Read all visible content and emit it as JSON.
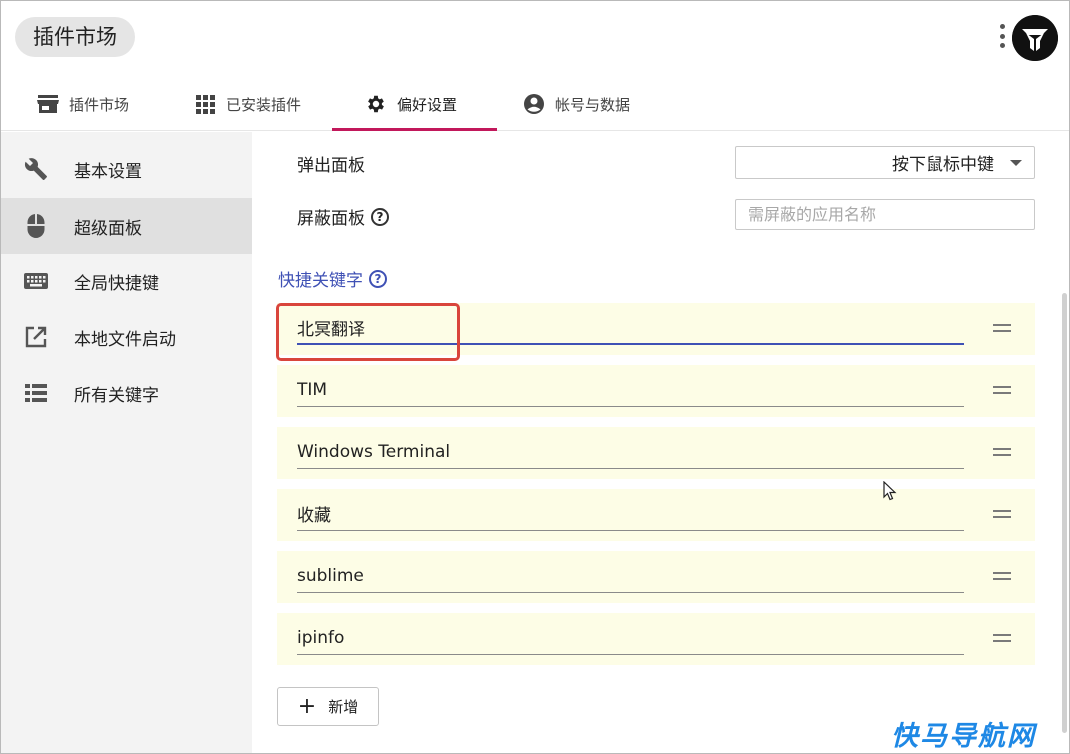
{
  "app": {
    "title": "插件市场"
  },
  "tabs": [
    {
      "label": "插件市场",
      "icon": "store-icon"
    },
    {
      "label": "已安装插件",
      "icon": "grid-icon"
    },
    {
      "label": "偏好设置",
      "icon": "gear-icon"
    },
    {
      "label": "帐号与数据",
      "icon": "account-icon"
    }
  ],
  "active_tab": "偏好设置",
  "sidebar": {
    "items": [
      {
        "label": "基本设置",
        "icon": "wrench-icon"
      },
      {
        "label": "超级面板",
        "icon": "mouse-icon"
      },
      {
        "label": "全局快捷键",
        "icon": "keyboard-icon"
      },
      {
        "label": "本地文件启动",
        "icon": "external-link-icon"
      },
      {
        "label": "所有关键字",
        "icon": "list-icon"
      }
    ],
    "active": "超级面板"
  },
  "settings": {
    "popup_label": "弹出面板",
    "popup_value": "按下鼠标中键",
    "block_label": "屏蔽面板",
    "block_placeholder": "需屏蔽的应用名称",
    "help_glyph": "?"
  },
  "keywords": {
    "title": "快捷关键字",
    "items": [
      "北冥翻译",
      "TIM",
      "Windows Terminal",
      "收藏",
      "sublime",
      "ipinfo"
    ],
    "add_label": "新增",
    "add_glyph": "+"
  },
  "watermark": "快马导航网",
  "colors": {
    "accent": "#3f51b5",
    "tab_indicator": "#c2185b",
    "row_bg": "#fdfde6",
    "highlight": "#d9453c"
  }
}
